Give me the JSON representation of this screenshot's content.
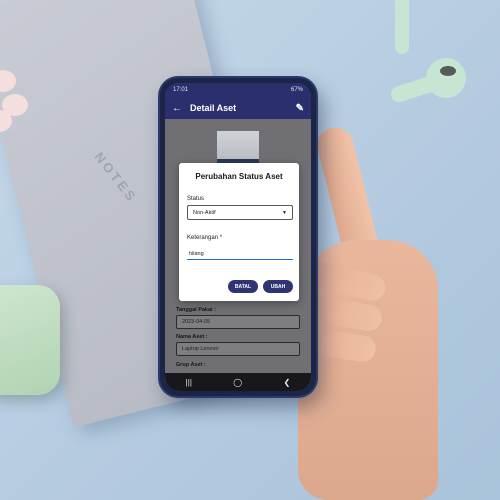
{
  "status_bar": {
    "time": "17:01",
    "battery": "67%"
  },
  "app_bar": {
    "title": "Detail Aset"
  },
  "dialog": {
    "title": "Perubahan Status Aset",
    "status_label": "Status",
    "status_value": "Non-Aktif",
    "note_label": "Keterangan *",
    "note_value": "hilang",
    "cancel_label": "BATAL",
    "save_label": "UBAH"
  },
  "fields": {
    "tanggal_label": "Tanggal Pakai :",
    "tanggal_value": "2023-04-05",
    "nama_label": "Nama Aset :",
    "nama_value": "Laptop Lenovo",
    "grup_label": "Grup Aset :"
  },
  "background": {
    "notebook_text": "NOTES"
  },
  "colors": {
    "app_bar": "#2c2f6e",
    "button": "#2f3473",
    "input_underline": "#1f6bd6"
  }
}
